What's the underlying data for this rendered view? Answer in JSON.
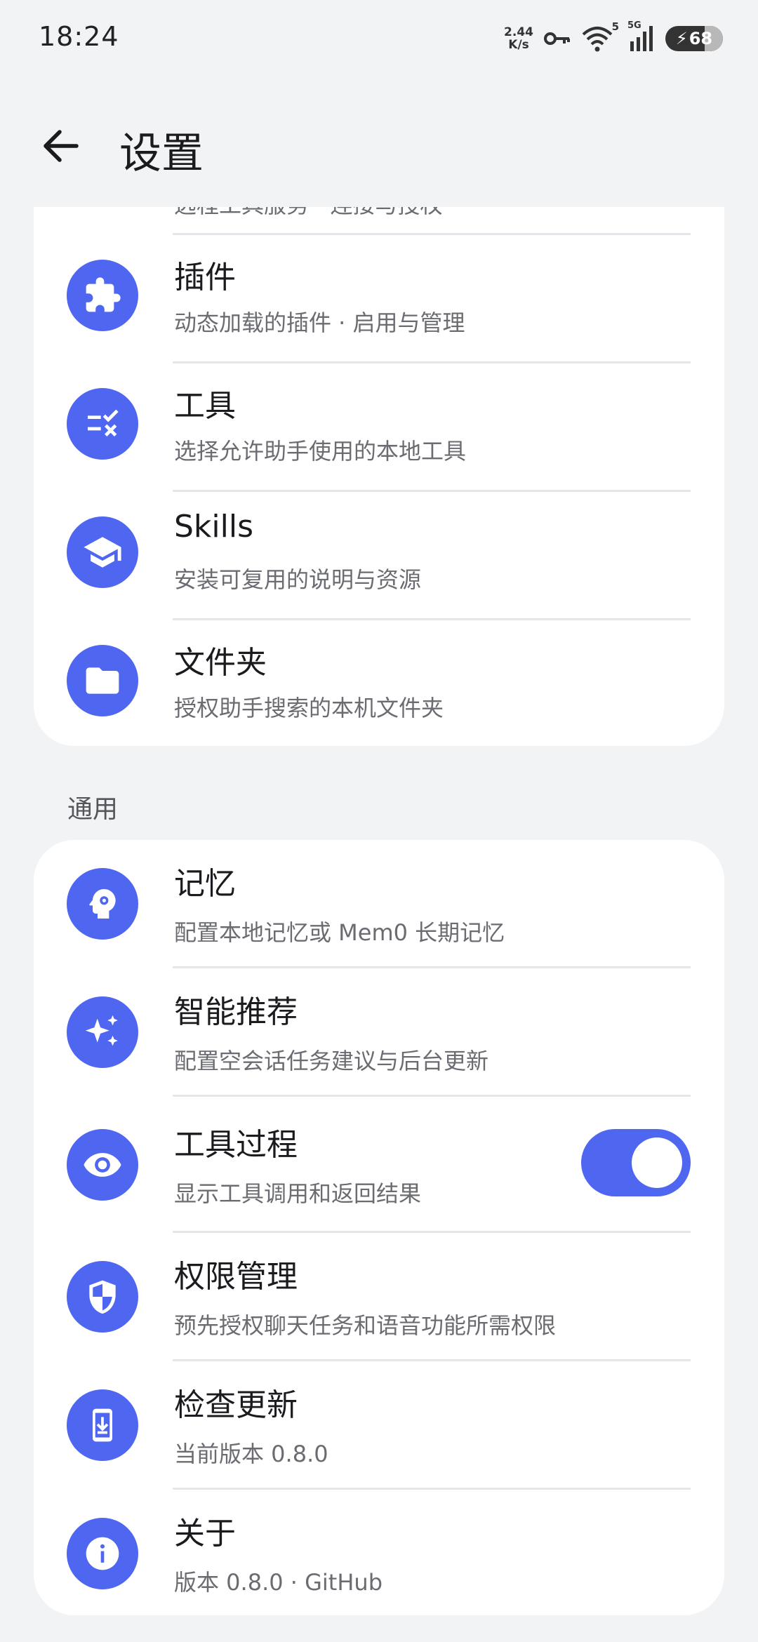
{
  "status_bar": {
    "time": "18:24",
    "net_speed_value": "2.44",
    "net_speed_unit": "K/s",
    "wifi_badge": "5",
    "cell_badge": "5G",
    "battery": "68"
  },
  "app_bar": {
    "title": "设置"
  },
  "top_card": {
    "partial_subtitle": "远程工具服务 · 连接与授权",
    "items": [
      {
        "title": "插件",
        "subtitle": "动态加载的插件 · 启用与管理",
        "icon": "puzzle-icon"
      },
      {
        "title": "工具",
        "subtitle": "选择允许助手使用的本地工具",
        "icon": "checklist-icon"
      },
      {
        "title": "Skills",
        "subtitle": "安装可复用的说明与资源",
        "icon": "graduation-cap-icon"
      },
      {
        "title": "文件夹",
        "subtitle": "授权助手搜索的本机文件夹",
        "icon": "folder-icon"
      }
    ]
  },
  "general_section": {
    "label": "通用",
    "items": [
      {
        "title": "记忆",
        "subtitle": "配置本地记忆或 Mem0 长期记忆",
        "icon": "head-gear-icon"
      },
      {
        "title": "智能推荐",
        "subtitle": "配置空会话任务建议与后台更新",
        "icon": "sparkles-icon"
      },
      {
        "title": "工具过程",
        "subtitle": "显示工具调用和返回结果",
        "icon": "eye-icon",
        "toggle_on": true
      },
      {
        "title": "权限管理",
        "subtitle": "预先授权聊天任务和语音功能所需权限",
        "icon": "shield-icon"
      },
      {
        "title": "检查更新",
        "subtitle": "当前版本 0.8.0",
        "icon": "phone-download-icon"
      },
      {
        "title": "关于",
        "subtitle": "版本 0.8.0 · GitHub",
        "icon": "info-icon"
      }
    ]
  },
  "colors": {
    "accent": "#4f67f0",
    "background": "#f2f3f5",
    "card": "#ffffff"
  }
}
